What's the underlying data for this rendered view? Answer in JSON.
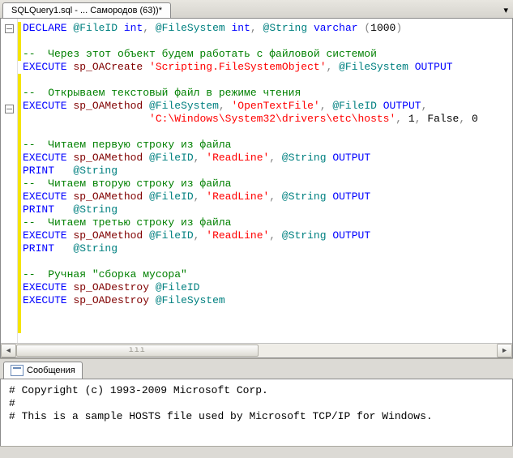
{
  "tab": {
    "title": "SQLQuery1.sql - ... Самородов (63))*"
  },
  "dropdown_glyph": "▾",
  "gutter": {
    "fold_lines": [
      1,
      7
    ]
  },
  "yellow_bars": [
    {
      "from": 1,
      "to": 3
    },
    {
      "from": 5,
      "to": 24
    }
  ],
  "code": [
    [
      {
        "t": "DECLARE",
        "c": "kw"
      },
      {
        "t": " "
      },
      {
        "t": "@FileID",
        "c": "var"
      },
      {
        "t": " "
      },
      {
        "t": "int",
        "c": "kw"
      },
      {
        "t": ", ",
        "c": "gray"
      },
      {
        "t": "@FileSystem",
        "c": "var"
      },
      {
        "t": " "
      },
      {
        "t": "int",
        "c": "kw"
      },
      {
        "t": ", ",
        "c": "gray"
      },
      {
        "t": "@String",
        "c": "var"
      },
      {
        "t": " "
      },
      {
        "t": "varchar",
        "c": "kw"
      },
      {
        "t": " (",
        "c": "gray"
      },
      {
        "t": "1000"
      },
      {
        "t": ")",
        "c": "gray"
      }
    ],
    [],
    [
      {
        "t": "--  Через этот объект будем работать с файловой системой",
        "c": "cmt"
      }
    ],
    [
      {
        "t": "EXECUTE",
        "c": "kw"
      },
      {
        "t": " "
      },
      {
        "t": "sp_OACreate",
        "c": "sys"
      },
      {
        "t": " "
      },
      {
        "t": "'Scripting.FileSystemObject'",
        "c": "str"
      },
      {
        "t": ", ",
        "c": "gray"
      },
      {
        "t": "@FileSystem",
        "c": "var"
      },
      {
        "t": " "
      },
      {
        "t": "OUTPUT",
        "c": "kw"
      }
    ],
    [],
    [
      {
        "t": "--  Открываем текстовый файл в режиме чтения",
        "c": "cmt"
      }
    ],
    [
      {
        "t": "EXECUTE",
        "c": "kw"
      },
      {
        "t": " "
      },
      {
        "t": "sp_OAMethod",
        "c": "sys"
      },
      {
        "t": " "
      },
      {
        "t": "@FileSystem",
        "c": "var"
      },
      {
        "t": ", ",
        "c": "gray"
      },
      {
        "t": "'OpenTextFile'",
        "c": "str"
      },
      {
        "t": ", ",
        "c": "gray"
      },
      {
        "t": "@FileID",
        "c": "var"
      },
      {
        "t": " "
      },
      {
        "t": "OUTPUT",
        "c": "kw"
      },
      {
        "t": ",",
        "c": "gray"
      }
    ],
    [
      {
        "t": "                    "
      },
      {
        "t": "'C:\\Windows\\System32\\drivers\\etc\\hosts'",
        "c": "str"
      },
      {
        "t": ", ",
        "c": "gray"
      },
      {
        "t": "1"
      },
      {
        "t": ", ",
        "c": "gray"
      },
      {
        "t": "False"
      },
      {
        "t": ", ",
        "c": "gray"
      },
      {
        "t": "0"
      }
    ],
    [],
    [
      {
        "t": "--  Читаем первую строку из файла",
        "c": "cmt"
      }
    ],
    [
      {
        "t": "EXECUTE",
        "c": "kw"
      },
      {
        "t": " "
      },
      {
        "t": "sp_OAMethod",
        "c": "sys"
      },
      {
        "t": " "
      },
      {
        "t": "@FileID",
        "c": "var"
      },
      {
        "t": ", ",
        "c": "gray"
      },
      {
        "t": "'ReadLine'",
        "c": "str"
      },
      {
        "t": ", ",
        "c": "gray"
      },
      {
        "t": "@String",
        "c": "var"
      },
      {
        "t": " "
      },
      {
        "t": "OUTPUT",
        "c": "kw"
      }
    ],
    [
      {
        "t": "PRINT",
        "c": "kw"
      },
      {
        "t": "   "
      },
      {
        "t": "@String",
        "c": "var"
      }
    ],
    [
      {
        "t": "--  Читаем вторую строку из файла",
        "c": "cmt"
      }
    ],
    [
      {
        "t": "EXECUTE",
        "c": "kw"
      },
      {
        "t": " "
      },
      {
        "t": "sp_OAMethod",
        "c": "sys"
      },
      {
        "t": " "
      },
      {
        "t": "@FileID",
        "c": "var"
      },
      {
        "t": ", ",
        "c": "gray"
      },
      {
        "t": "'ReadLine'",
        "c": "str"
      },
      {
        "t": ", ",
        "c": "gray"
      },
      {
        "t": "@String",
        "c": "var"
      },
      {
        "t": " "
      },
      {
        "t": "OUTPUT",
        "c": "kw"
      }
    ],
    [
      {
        "t": "PRINT",
        "c": "kw"
      },
      {
        "t": "   "
      },
      {
        "t": "@String",
        "c": "var"
      }
    ],
    [
      {
        "t": "--  Читаем третью строку из файла",
        "c": "cmt"
      }
    ],
    [
      {
        "t": "EXECUTE",
        "c": "kw"
      },
      {
        "t": " "
      },
      {
        "t": "sp_OAMethod",
        "c": "sys"
      },
      {
        "t": " "
      },
      {
        "t": "@FileID",
        "c": "var"
      },
      {
        "t": ", ",
        "c": "gray"
      },
      {
        "t": "'ReadLine'",
        "c": "str"
      },
      {
        "t": ", ",
        "c": "gray"
      },
      {
        "t": "@String",
        "c": "var"
      },
      {
        "t": " "
      },
      {
        "t": "OUTPUT",
        "c": "kw"
      }
    ],
    [
      {
        "t": "PRINT",
        "c": "kw"
      },
      {
        "t": "   "
      },
      {
        "t": "@String",
        "c": "var"
      }
    ],
    [],
    [
      {
        "t": "--  Ручная \"сборка мусора\"",
        "c": "cmt"
      }
    ],
    [
      {
        "t": "EXECUTE",
        "c": "kw"
      },
      {
        "t": " "
      },
      {
        "t": "sp_OADestroy",
        "c": "sys"
      },
      {
        "t": " "
      },
      {
        "t": "@FileID",
        "c": "var"
      }
    ],
    [
      {
        "t": "EXECUTE",
        "c": "kw"
      },
      {
        "t": " "
      },
      {
        "t": "sp_OADestroy",
        "c": "sys"
      },
      {
        "t": " "
      },
      {
        "t": "@FileSystem",
        "c": "var"
      }
    ]
  ],
  "scrollbar": {
    "left_glyph": "◄",
    "right_glyph": "►",
    "thumb_glyph": "ııı"
  },
  "results": {
    "tab_label": "Сообщения",
    "lines": [
      "# Copyright (c) 1993-2009 Microsoft Corp.",
      "#",
      "# This is a sample HOSTS file used by Microsoft TCP/IP for Windows."
    ]
  }
}
